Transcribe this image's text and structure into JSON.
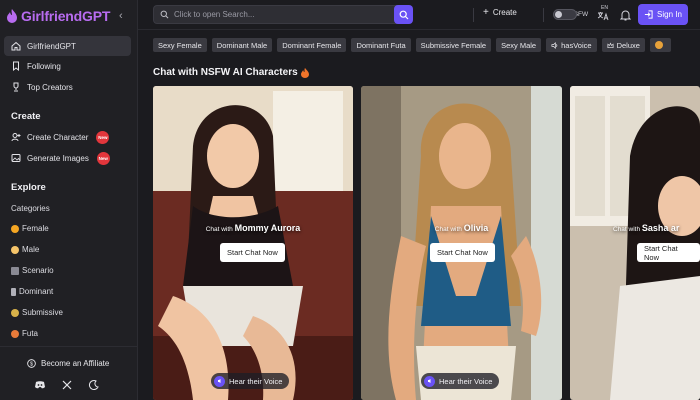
{
  "app": {
    "name": "GirlfriendGPT"
  },
  "sidebar": {
    "top_items": [
      {
        "label": "GirlfriendGPT",
        "icon": "home-icon",
        "active": true
      },
      {
        "label": "Following",
        "icon": "bookmark-icon",
        "active": false
      },
      {
        "label": "Top Creators",
        "icon": "trophy-icon",
        "active": false
      }
    ],
    "create_title": "Create",
    "create_items": [
      {
        "label": "Create Character",
        "badge": "New",
        "icon": "create-character-icon"
      },
      {
        "label": "Generate Images",
        "badge": "New",
        "icon": "image-icon"
      }
    ],
    "explore_title": "Explore",
    "categories_label": "Categories",
    "categories": [
      {
        "label": "Female",
        "emoji_color": "#f5a623"
      },
      {
        "label": "Male",
        "emoji_color": "#f5c46a"
      },
      {
        "label": "Scenario",
        "emoji_color": "#8a8a94"
      },
      {
        "label": "Dominant",
        "emoji_color": "#b0b0b8"
      },
      {
        "label": "Submissive",
        "emoji_color": "#d8b24a"
      },
      {
        "label": "Futa",
        "emoji_color": "#e87b3a"
      }
    ],
    "affiliate_label": "Become an Affiliate",
    "social_icons": [
      "discord-icon",
      "x-icon",
      "dark-mode-icon"
    ]
  },
  "topbar": {
    "search_placeholder": "Click to open Search...",
    "create_label": "Create",
    "nsfw_label": "NSFW",
    "lang_badge": "EN",
    "signin_label": "Sign In"
  },
  "tags": [
    {
      "label": "Sexy Female"
    },
    {
      "label": "Dominant Male"
    },
    {
      "label": "Dominant Female"
    },
    {
      "label": "Dominant Futa"
    },
    {
      "label": "Submissive Female"
    },
    {
      "label": "Sexy Male"
    },
    {
      "label": "hasVoice",
      "icon": "voice-icon"
    },
    {
      "label": "Deluxe",
      "icon": "crown-icon"
    },
    {
      "label": "",
      "icon": "emoji-icon"
    }
  ],
  "main": {
    "title": "Chat with NSFW AI Characters"
  },
  "cards": [
    {
      "prefix": "Chat with ",
      "name": "Mommy Aurora",
      "start_label": "Start Chat Now",
      "voice_label": "Hear their Voice"
    },
    {
      "prefix": "Chat with ",
      "name": "Olivia",
      "start_label": "Start Chat Now",
      "voice_label": "Hear their Voice"
    },
    {
      "prefix": "Chat with ",
      "name": "Sasha ar",
      "start_label": "Start Chat Now",
      "voice_label": ""
    }
  ],
  "colors": {
    "accent": "#6a52f5",
    "logo": "#b86cf0",
    "badge": "#e2363c"
  }
}
